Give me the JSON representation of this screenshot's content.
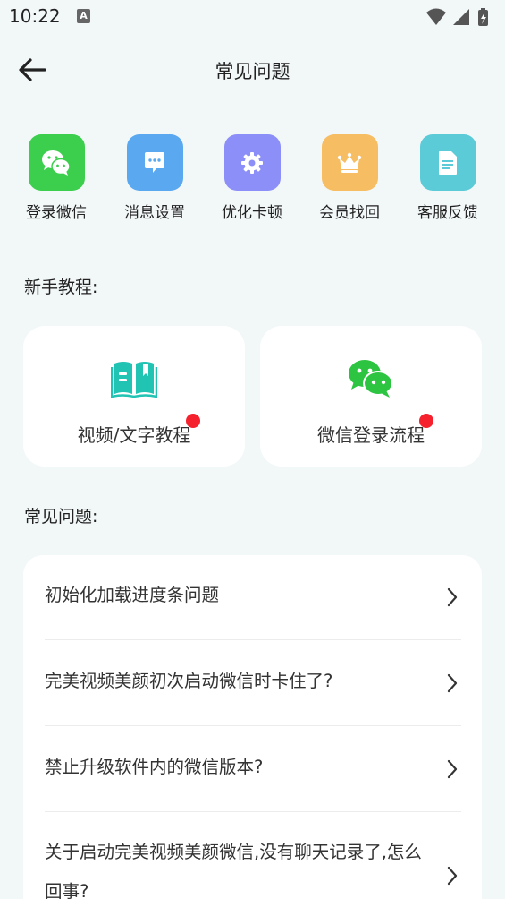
{
  "status_bar": {
    "time": "10:22",
    "notification_letter": "A",
    "icons": [
      "wifi-icon",
      "signal-icon",
      "battery-charging-icon"
    ]
  },
  "header": {
    "title": "常见问题",
    "back_icon": "arrow-left-icon"
  },
  "quick_actions": [
    {
      "label": "登录微信",
      "icon": "wechat-icon",
      "color": "#3ccf4e"
    },
    {
      "label": "消息设置",
      "icon": "message-icon",
      "color": "#5aa9f0"
    },
    {
      "label": "优化卡顿",
      "icon": "gear-icon",
      "color": "#8c8ff7"
    },
    {
      "label": "会员找回",
      "icon": "crown-icon",
      "color": "#f6bd62"
    },
    {
      "label": "客服反馈",
      "icon": "document-icon",
      "color": "#5ccbd8"
    }
  ],
  "tutorials": {
    "title": "新手教程:",
    "items": [
      {
        "label": "视频/文字教程",
        "icon": "book-icon",
        "icon_color": "#21c3b3",
        "has_badge": true
      },
      {
        "label": "微信登录流程",
        "icon": "wechat-icon",
        "icon_color": "#2dc441",
        "has_badge": true
      }
    ]
  },
  "faq": {
    "title": "常见问题:",
    "items": [
      {
        "text": "初始化加载进度条问题"
      },
      {
        "text": "完美视频美颜初次启动微信时卡住了?"
      },
      {
        "text": "禁止升级软件内的微信版本?"
      },
      {
        "text": "关于启动完美视频美颜微信,没有聊天记录了,怎么回事?"
      }
    ]
  },
  "colors": {
    "background": "#f2f7f8",
    "card": "#ffffff",
    "badge": "#f5222d"
  }
}
